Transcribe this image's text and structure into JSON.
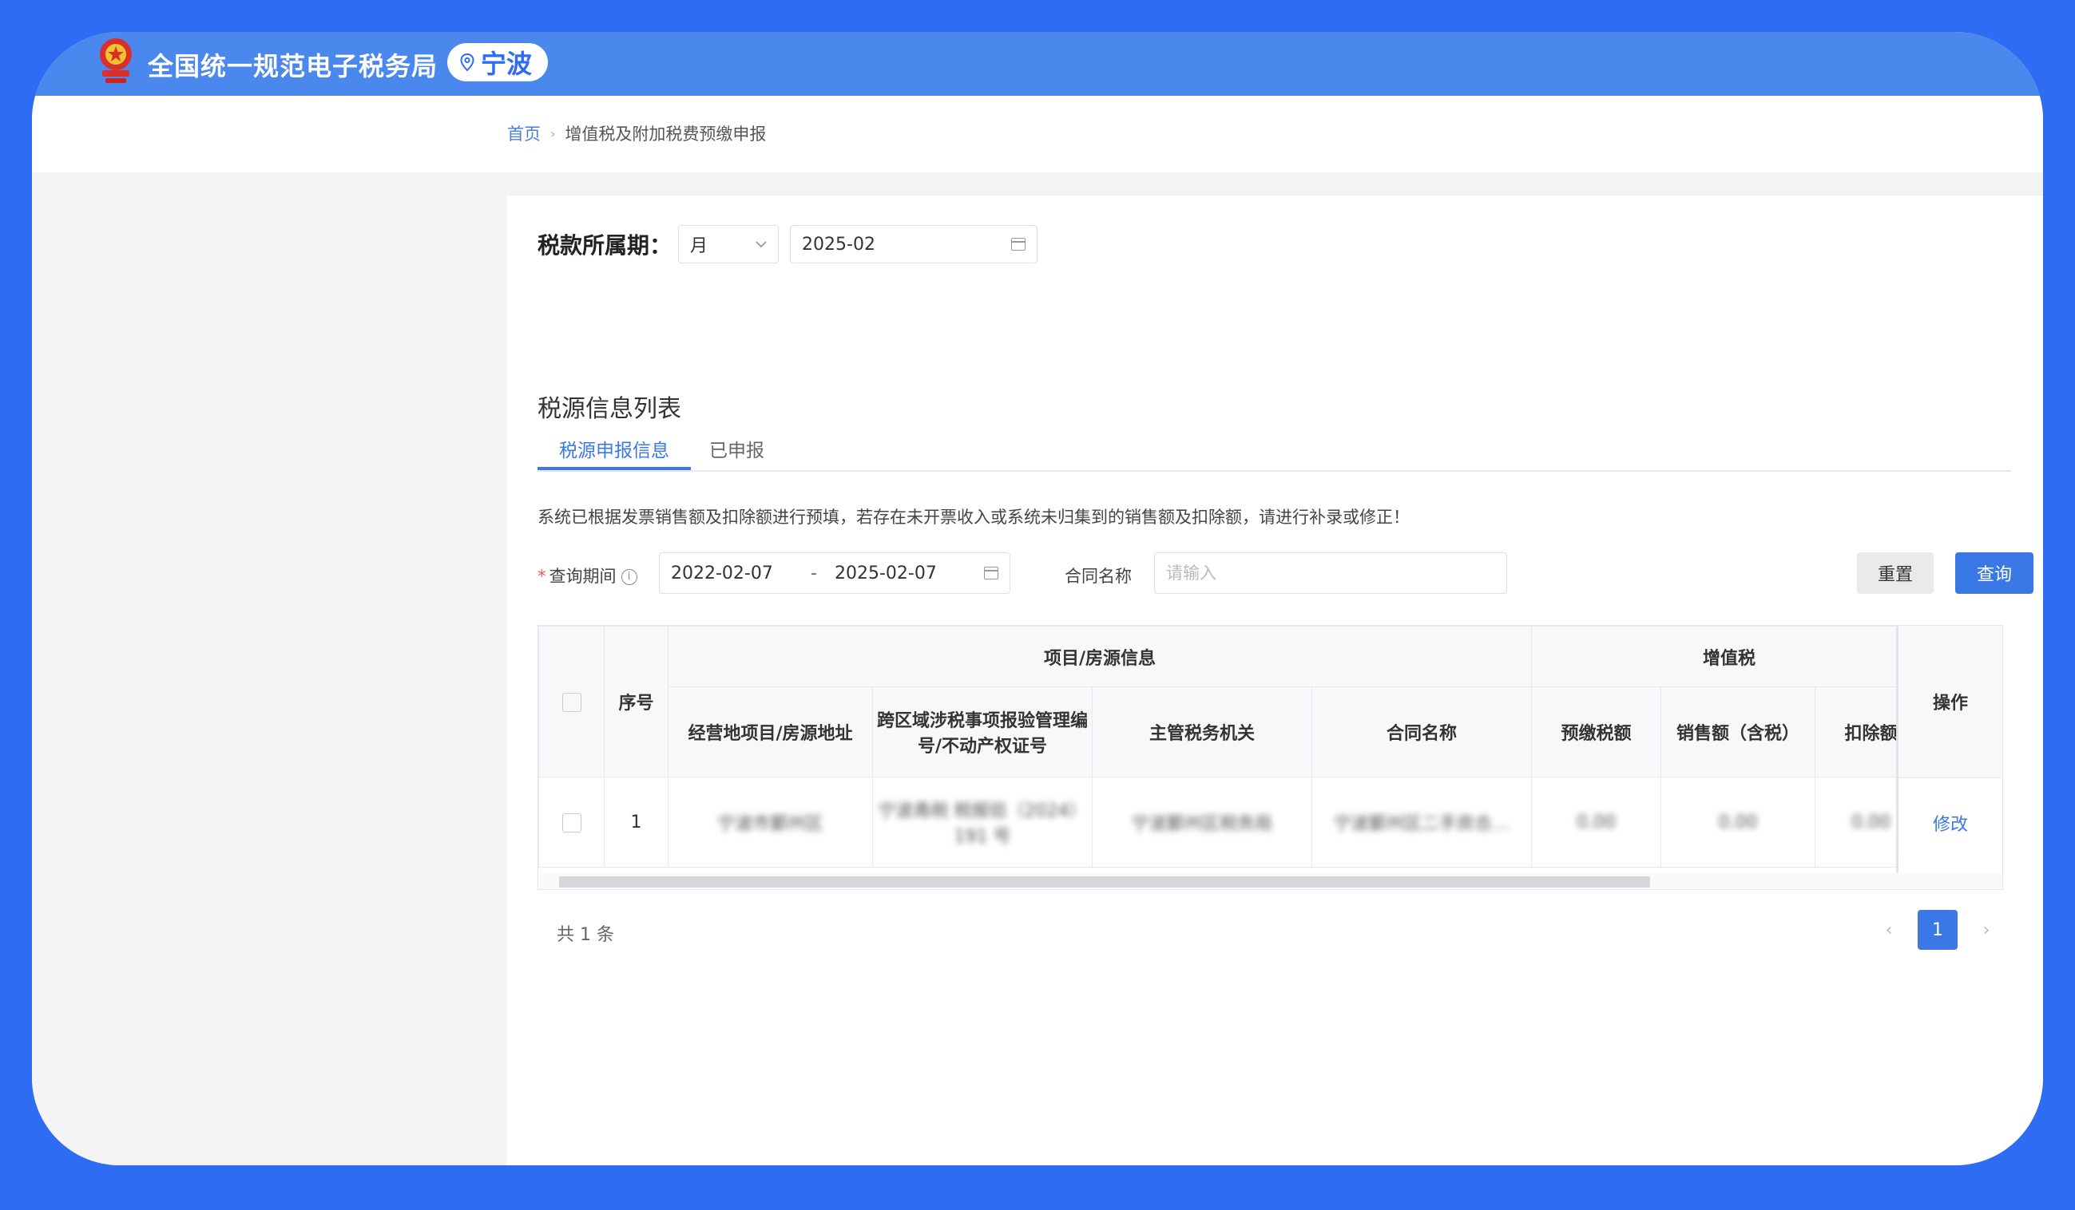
{
  "colors": {
    "frame": "#2f6cf4",
    "header": "#4a88ee",
    "primary": "#3a78e6"
  },
  "header": {
    "site_title": "全国统一规范电子税务局",
    "region": "宁波",
    "emblem_icon": "national-emblem-icon",
    "location_icon": "location-pin-icon"
  },
  "breadcrumb": {
    "home": "首页",
    "separator": "›",
    "current": "增值税及附加税费预缴申报"
  },
  "period": {
    "label": "税款所属期：",
    "unit": "月",
    "value": "2025-02"
  },
  "section_title": "税源信息列表",
  "tabs": [
    {
      "label": "税源申报信息",
      "active": true
    },
    {
      "label": "已申报",
      "active": false
    }
  ],
  "notice": "系统已根据发票销售额及扣除额进行预填，若存在未开票收入或系统未归集到的销售额及扣除额，请进行补录或修正！",
  "query": {
    "period_label": "查询期间",
    "required_mark": "*",
    "start": "2022-02-07",
    "separator": "-",
    "end": "2025-02-07",
    "contract_label": "合同名称",
    "contract_placeholder": "请输入",
    "reset_label": "重置",
    "query_label": "查询"
  },
  "table": {
    "group_headers": {
      "project": "项目/房源信息",
      "vat": "增值税"
    },
    "columns": {
      "seq": "序号",
      "address": "经营地项目/房源地址",
      "cert": "跨区域涉税事项报验管理编号/不动产权证号",
      "authority": "主管税务机关",
      "contract": "合同名称",
      "prepaid": "预缴税额",
      "sales": "销售额（含税）",
      "deduction": "扣除额",
      "action": "操作"
    },
    "rows": [
      {
        "seq": "1",
        "address": "宁波市鄞州区",
        "cert": "宁波甬税 税报验（2024）191 号",
        "authority": "宁波鄞州区税务局",
        "contract": "宁波鄞州区二手房合…",
        "prepaid": "0.00",
        "sales": "0.00",
        "deduction": "0.00",
        "action": "修改"
      }
    ]
  },
  "pagination": {
    "total_text": "共 1 条",
    "current_page": "1",
    "prev": "‹",
    "next": "›"
  }
}
